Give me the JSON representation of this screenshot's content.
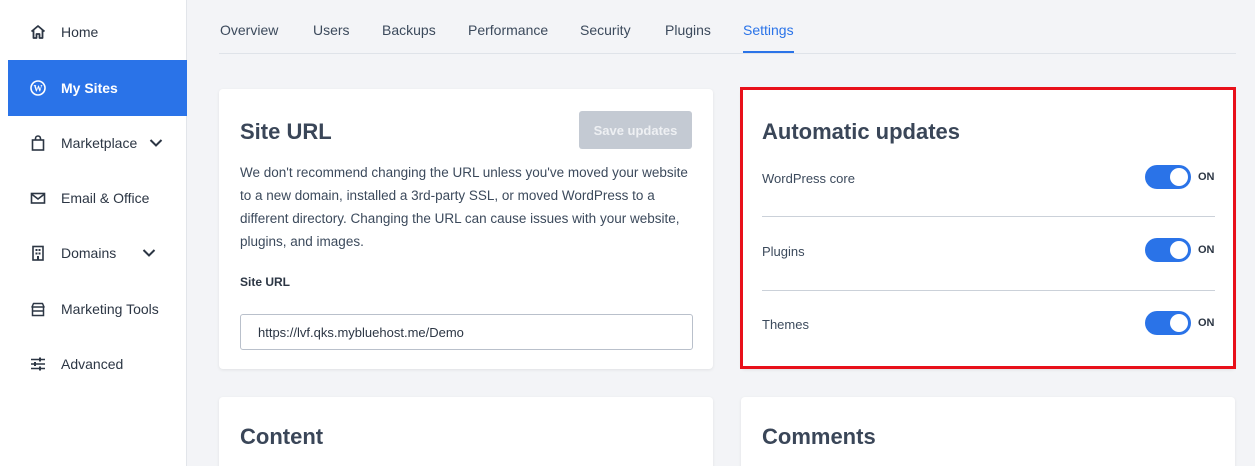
{
  "sidebar": {
    "items": [
      {
        "label": "Home",
        "icon": "home-icon"
      },
      {
        "label": "My Sites",
        "icon": "wordpress-icon",
        "active": true
      },
      {
        "label": "Marketplace",
        "icon": "shopping-bag-icon"
      },
      {
        "label": "Email & Office",
        "icon": "mail-icon"
      },
      {
        "label": "Domains",
        "icon": "building-icon"
      },
      {
        "label": "Marketing Tools",
        "icon": "store-icon"
      },
      {
        "label": "Advanced",
        "icon": "sliders-icon"
      }
    ]
  },
  "tabs": [
    {
      "label": "Overview"
    },
    {
      "label": "Users"
    },
    {
      "label": "Backups"
    },
    {
      "label": "Performance"
    },
    {
      "label": "Security"
    },
    {
      "label": "Plugins"
    },
    {
      "label": "Settings",
      "active": true
    }
  ],
  "site_url_card": {
    "title": "Site URL",
    "save_label": "Save updates",
    "description": "We don't recommend changing the URL unless you've moved your website to a new domain, installed a 3rd-party SSL, or moved WordPress to a different directory. Changing the URL can cause issues with your website, plugins, and images.",
    "field_label": "Site URL",
    "field_value": "https://lvf.qks.mybluehost.me/Demo"
  },
  "auto_updates_card": {
    "title": "Automatic updates",
    "rows": [
      {
        "label": "WordPress core",
        "state": "ON"
      },
      {
        "label": "Plugins",
        "state": "ON"
      },
      {
        "label": "Themes",
        "state": "ON"
      }
    ]
  },
  "content_card": {
    "title": "Content"
  },
  "comments_card": {
    "title": "Comments"
  },
  "colors": {
    "accent": "#2a73e8",
    "highlight": "#e8101a"
  }
}
